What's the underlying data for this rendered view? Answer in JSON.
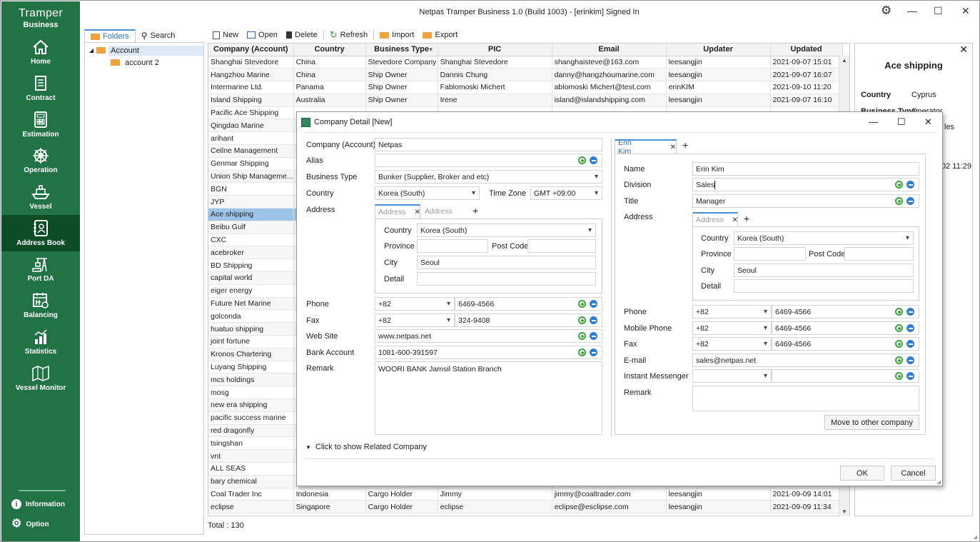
{
  "app": {
    "brand_title": "Tramper",
    "brand_subtitle": "Business",
    "window_title": "Netpas Tramper Business 1.0 (Build 1003) - [erinkim] Signed In"
  },
  "sidebar": {
    "items": [
      {
        "label": "Home",
        "icon": "home-icon"
      },
      {
        "label": "Contract",
        "icon": "contract-icon"
      },
      {
        "label": "Estimation",
        "icon": "calculator-icon"
      },
      {
        "label": "Operation",
        "icon": "ship-wheel-icon"
      },
      {
        "label": "Vessel",
        "icon": "vessel-icon"
      },
      {
        "label": "Address Book",
        "icon": "address-book-icon",
        "active": true
      },
      {
        "label": "Port DA",
        "icon": "port-crane-icon"
      },
      {
        "label": "Balancing",
        "icon": "calendar-balance-icon"
      },
      {
        "label": "Statistics",
        "icon": "statistics-icon"
      },
      {
        "label": "Vessel Monitor",
        "icon": "map-icon"
      }
    ],
    "information": "Information",
    "option": "Option"
  },
  "folders": {
    "tab_folders": "Folders",
    "tab_search": "Search",
    "tree": [
      {
        "label": "Account",
        "level": 0,
        "selected": true
      },
      {
        "label": "account 2",
        "level": 1
      }
    ]
  },
  "toolbar": {
    "new": "New",
    "open": "Open",
    "delete": "Delete",
    "refresh": "Refresh",
    "import": "Import",
    "export": "Export"
  },
  "grid": {
    "columns": [
      "Company (Account)",
      "Country",
      "Business Type",
      "PIC",
      "Email",
      "Updater",
      "Updated"
    ],
    "rows": [
      [
        "Shanghai Stevedore",
        "China",
        "Stevedore Company",
        "Shanghai Stevedore",
        "shanghaisteve@163.com",
        "leesangjin",
        "2021-09-07 15:01"
      ],
      [
        "Hangzhou Marine",
        "China",
        "Ship Owner",
        "Dannis Chung",
        "danny@hangzhoumarine.com",
        "leesangjin",
        "2021-09-07 16:07"
      ],
      [
        "Intermarine Ltd.",
        "Panama",
        "Ship Owner",
        "Fablomoski Michert",
        "ablomoski Michert@test.com",
        "erinKIM",
        "2021-09-10 11:20"
      ],
      [
        "Island Shipping",
        "Australia",
        "Ship Owner",
        "Irene",
        "island@islandshipping.com",
        "leesangjin",
        "2021-09-07 16:10"
      ],
      [
        "Pacific Ace Shipping",
        "",
        "",
        "",
        "",
        "",
        ""
      ],
      [
        "Qingdao Marine",
        "",
        "",
        "",
        "",
        "",
        ""
      ],
      [
        "arihant",
        "",
        "",
        "",
        "",
        "",
        ""
      ],
      [
        "Ceilne Management",
        "",
        "",
        "",
        "",
        "",
        ""
      ],
      [
        "Genmar Shipping",
        "",
        "",
        "",
        "",
        "",
        ""
      ],
      [
        "Union Ship Manageme...",
        "",
        "",
        "",
        "",
        "",
        ""
      ],
      [
        "BGN",
        "",
        "",
        "",
        "",
        "",
        ""
      ],
      [
        "JYP",
        "",
        "",
        "",
        "",
        "",
        ""
      ],
      [
        "Ace shipping",
        "",
        "",
        "",
        "",
        "",
        ""
      ],
      [
        "Beibu Gulf",
        "",
        "",
        "",
        "",
        "",
        ""
      ],
      [
        "CXC",
        "",
        "",
        "",
        "",
        "",
        ""
      ],
      [
        "acebroker",
        "",
        "",
        "",
        "",
        "",
        ""
      ],
      [
        "BD Shipping",
        "",
        "",
        "",
        "",
        "",
        ""
      ],
      [
        "capital world",
        "",
        "",
        "",
        "",
        "",
        ""
      ],
      [
        "eiger energy",
        "",
        "",
        "",
        "",
        "",
        ""
      ],
      [
        "Future Net Marine",
        "",
        "",
        "",
        "",
        "",
        ""
      ],
      [
        "golconda",
        "",
        "",
        "",
        "",
        "",
        ""
      ],
      [
        "huatuo shipping",
        "",
        "",
        "",
        "",
        "",
        ""
      ],
      [
        "joint fortune",
        "",
        "",
        "",
        "",
        "",
        ""
      ],
      [
        "Kronos Chartering",
        "",
        "",
        "",
        "",
        "",
        ""
      ],
      [
        "Luyang Shipping",
        "",
        "",
        "",
        "",
        "",
        ""
      ],
      [
        "mcs holdings",
        "",
        "",
        "",
        "",
        "",
        ""
      ],
      [
        "mosg",
        "",
        "",
        "",
        "",
        "",
        ""
      ],
      [
        "new era shipping",
        "",
        "",
        "",
        "",
        "",
        ""
      ],
      [
        "pacific success marine",
        "",
        "",
        "",
        "",
        "",
        ""
      ],
      [
        "red dragonfly",
        "",
        "",
        "",
        "",
        "",
        ""
      ],
      [
        "tsingshan",
        "",
        "",
        "",
        "",
        "",
        ""
      ],
      [
        "vnt",
        "",
        "",
        "",
        "",
        "",
        ""
      ],
      [
        "ALL SEAS",
        "",
        "",
        "",
        "",
        "",
        ""
      ],
      [
        "bary chemical",
        "",
        "",
        "",
        "",
        "",
        ""
      ],
      [
        "Coal Trader Inc",
        "Indonesia",
        "Cargo Holder",
        "Jimmy",
        "jimmy@coaltrader.com",
        "leesangjin",
        "2021-09-09 14:01"
      ],
      [
        "eclipse",
        "Singapore",
        "Cargo Holder",
        "eclipse",
        "eclipse@esclipse.com",
        "leesangjin",
        "2021-09-09 11:34"
      ]
    ],
    "selected_row": 12,
    "total": "Total : 130"
  },
  "detail_panel": {
    "title": "Ace shipping",
    "country_label": "Country",
    "country_value": "Cyprus",
    "business_type_label": "Business Type",
    "business_type_value": "Operator",
    "partial_text": "les",
    "partial_date": "02 11:29"
  },
  "dialog": {
    "title": "Company Detail [New]",
    "company": {
      "company_label": "Company (Account)",
      "company_value": "Netpas",
      "alias_label": "Alias",
      "alias_value": "",
      "business_type_label": "Business Type",
      "business_type_value": "Bunker (Supplier, Broker and etc)",
      "country_label": "Country",
      "country_value": "Korea (South)",
      "timezone_label": "Time Zone",
      "timezone_value": "GMT +09:00",
      "address_label": "Address",
      "address_tabs": [
        "Address",
        "Address"
      ],
      "addr_country_label": "Country",
      "addr_country_value": "Korea (South)",
      "province_label": "Province",
      "province_value": "",
      "postcode_label": "Post Code",
      "postcode_value": "",
      "city_label": "City",
      "city_value": "Seoul",
      "detail_label": "Detail",
      "detail_value": "",
      "phone_label": "Phone",
      "phone_code": "+82",
      "phone_value": "6469-4566",
      "fax_label": "Fax",
      "fax_code": "+82",
      "fax_value": "324-9408",
      "website_label": "Web Site",
      "website_value": "www.netpas.net",
      "bank_label": "Bank Account",
      "bank_value": "1081-600-391597",
      "remark_label": "Remark",
      "remark_value": "WOORI BANK Jamsil Station Branch"
    },
    "related_toggle": "Click to show Related Company",
    "contact": {
      "tab_label": "Erin Kim",
      "name_label": "Name",
      "name_value": "Erin Kim",
      "division_label": "Division",
      "division_value": "Sales",
      "title_label": "Title",
      "title_value": "Manager",
      "address_label": "Address",
      "address_tab": "Address",
      "addr_country_label": "Country",
      "addr_country_value": "Korea (South)",
      "province_label": "Province",
      "province_value": "",
      "postcode_label": "Post Code",
      "postcode_value": "",
      "city_label": "City",
      "city_value": "Seoul",
      "detail_label": "Detail",
      "detail_value": "",
      "phone_label": "Phone",
      "phone_code": "+82",
      "phone_value": "6469-4566",
      "mobile_label": "Mobile Phone",
      "mobile_code": "+82",
      "mobile_value": "6469-4566",
      "fax_label": "Fax",
      "fax_code": "+82",
      "fax_value": "6469-4566",
      "email_label": "E-mail",
      "email_value": "sales@netpas.net",
      "im_label": "Instant Messenger",
      "im_type": "",
      "im_value": "",
      "remark_label": "Remark",
      "remark_value": "",
      "move_button": "Move to other company"
    },
    "ok": "OK",
    "cancel": "Cancel"
  },
  "colors": {
    "sidebar": "#217346",
    "sidebar_active": "#0f4d26",
    "selected_row": "#9dc3e6",
    "accent": "#4a90d9"
  }
}
